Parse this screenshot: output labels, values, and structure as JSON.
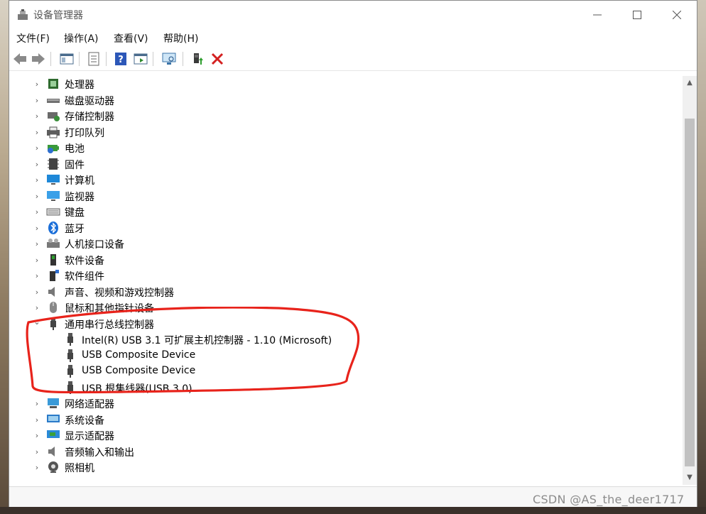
{
  "window": {
    "title": "设备管理器"
  },
  "menu": [
    "文件(F)",
    "操作(A)",
    "查看(V)",
    "帮助(H)"
  ],
  "toolbar_icons": [
    "back-arrow-icon",
    "forward-arrow-icon",
    "show-hide-tree-icon",
    "properties-icon",
    "help-icon",
    "run-icon",
    "monitor-scan-icon",
    "update-driver-icon",
    "uninstall-x-icon"
  ],
  "tree": {
    "categories": [
      {
        "label": "处理器",
        "icon": "cpu-icon"
      },
      {
        "label": "磁盘驱动器",
        "icon": "disk-icon"
      },
      {
        "label": "存储控制器",
        "icon": "storage-icon"
      },
      {
        "label": "打印队列",
        "icon": "printer-icon"
      },
      {
        "label": "电池",
        "icon": "battery-icon"
      },
      {
        "label": "固件",
        "icon": "firmware-icon"
      },
      {
        "label": "计算机",
        "icon": "computer-icon"
      },
      {
        "label": "监视器",
        "icon": "monitor-icon"
      },
      {
        "label": "键盘",
        "icon": "keyboard-icon"
      },
      {
        "label": "蓝牙",
        "icon": "bluetooth-icon"
      },
      {
        "label": "人机接口设备",
        "icon": "hid-icon"
      },
      {
        "label": "软件设备",
        "icon": "software-device-icon"
      },
      {
        "label": "软件组件",
        "icon": "software-component-icon"
      },
      {
        "label": "声音、视频和游戏控制器",
        "icon": "speaker-icon"
      },
      {
        "label": "鼠标和其他指针设备",
        "icon": "mouse-icon"
      }
    ],
    "usb": {
      "label": "通用串行总线控制器",
      "children": [
        "Intel(R) USB 3.1 可扩展主机控制器 - 1.10 (Microsoft)",
        "USB Composite Device",
        "USB Composite Device",
        "USB 根集线器(USB 3.0)"
      ]
    },
    "after": [
      {
        "label": "网络适配器",
        "icon": "network-icon"
      },
      {
        "label": "系统设备",
        "icon": "system-icon"
      },
      {
        "label": "显示适配器",
        "icon": "display-adapter-icon"
      },
      {
        "label": "音频输入和输出",
        "icon": "audio-io-icon"
      },
      {
        "label": "照相机",
        "icon": "camera-icon"
      }
    ]
  },
  "watermark": "CSDN @AS_the_deer1717",
  "colors": {
    "annotation": "#e8231b",
    "accent": "#1e6fd9"
  }
}
